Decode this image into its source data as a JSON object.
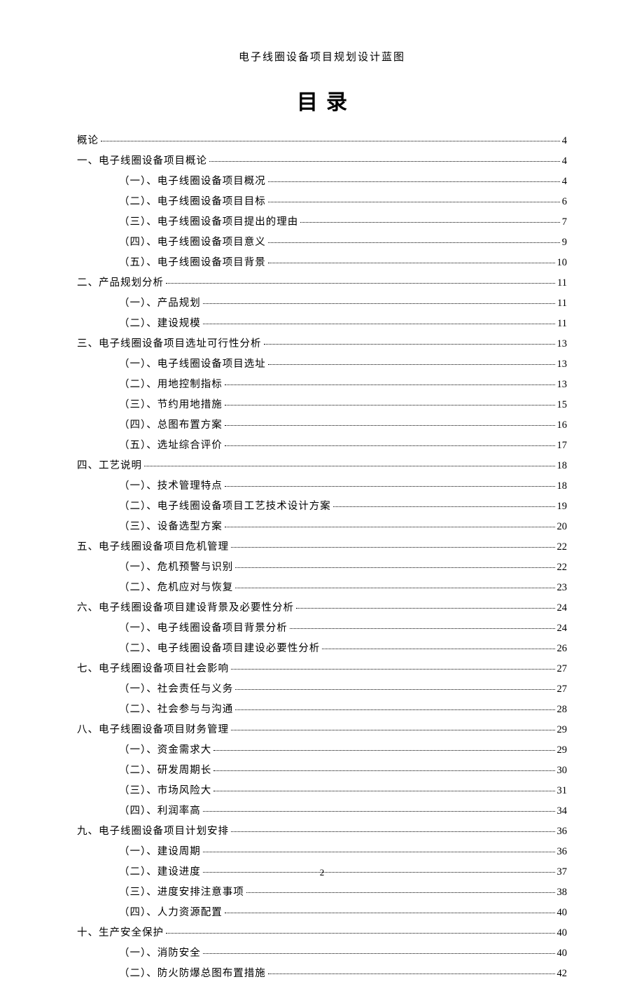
{
  "header": "电子线圈设备项目规划设计蓝图",
  "title": "目录",
  "page_number": "2",
  "toc": [
    {
      "level": 0,
      "label": "概论",
      "page": "4"
    },
    {
      "level": 1,
      "label": "一、电子线圈设备项目概论",
      "page": "4"
    },
    {
      "level": 2,
      "label": "（一）、电子线圈设备项目概况",
      "page": "4"
    },
    {
      "level": 2,
      "label": "（二）、电子线圈设备项目目标",
      "page": "6"
    },
    {
      "level": 2,
      "label": "（三）、电子线圈设备项目提出的理由",
      "page": "7"
    },
    {
      "level": 2,
      "label": "（四）、电子线圈设备项目意义",
      "page": "9"
    },
    {
      "level": 2,
      "label": "（五）、电子线圈设备项目背景",
      "page": "10"
    },
    {
      "level": 1,
      "label": "二、产品规划分析",
      "page": "11"
    },
    {
      "level": 2,
      "label": "（一）、产品规划",
      "page": "11"
    },
    {
      "level": 2,
      "label": "（二）、建设规模",
      "page": "11"
    },
    {
      "level": 1,
      "label": "三、电子线圈设备项目选址可行性分析",
      "page": "13"
    },
    {
      "level": 2,
      "label": "（一）、电子线圈设备项目选址",
      "page": "13"
    },
    {
      "level": 2,
      "label": "（二）、用地控制指标",
      "page": "13"
    },
    {
      "level": 2,
      "label": "（三）、节约用地措施",
      "page": "15"
    },
    {
      "level": 2,
      "label": "（四）、总图布置方案",
      "page": "16"
    },
    {
      "level": 2,
      "label": "（五）、选址综合评价",
      "page": "17"
    },
    {
      "level": 1,
      "label": "四、工艺说明",
      "page": "18"
    },
    {
      "level": 2,
      "label": "（一）、技术管理特点",
      "page": "18"
    },
    {
      "level": 2,
      "label": "（二）、电子线圈设备项目工艺技术设计方案",
      "page": "19"
    },
    {
      "level": 2,
      "label": "（三）、设备选型方案",
      "page": "20"
    },
    {
      "level": 1,
      "label": "五、电子线圈设备项目危机管理",
      "page": "22"
    },
    {
      "level": 2,
      "label": "（一）、危机预警与识别",
      "page": "22"
    },
    {
      "level": 2,
      "label": "（二）、危机应对与恢复",
      "page": "23"
    },
    {
      "level": 1,
      "label": "六、电子线圈设备项目建设背景及必要性分析",
      "page": "24"
    },
    {
      "level": 2,
      "label": "（一）、电子线圈设备项目背景分析",
      "page": "24"
    },
    {
      "level": 2,
      "label": "（二）、电子线圈设备项目建设必要性分析",
      "page": "26"
    },
    {
      "level": 1,
      "label": "七、电子线圈设备项目社会影响",
      "page": "27"
    },
    {
      "level": 2,
      "label": "（一）、社会责任与义务",
      "page": "27"
    },
    {
      "level": 2,
      "label": "（二）、社会参与与沟通",
      "page": "28"
    },
    {
      "level": 1,
      "label": "八、电子线圈设备项目财务管理",
      "page": "29"
    },
    {
      "level": 2,
      "label": "（一）、资金需求大",
      "page": "29"
    },
    {
      "level": 2,
      "label": "（二）、研发周期长",
      "page": "30"
    },
    {
      "level": 2,
      "label": "（三）、市场风险大",
      "page": "31"
    },
    {
      "level": 2,
      "label": "（四）、利润率高",
      "page": "34"
    },
    {
      "level": 1,
      "label": "九、电子线圈设备项目计划安排",
      "page": "36"
    },
    {
      "level": 2,
      "label": "（一）、建设周期",
      "page": "36"
    },
    {
      "level": 2,
      "label": "（二）、建设进度",
      "page": "37"
    },
    {
      "level": 2,
      "label": "（三）、进度安排注意事项",
      "page": "38"
    },
    {
      "level": 2,
      "label": "（四）、人力资源配置",
      "page": "40"
    },
    {
      "level": 1,
      "label": "十、生产安全保护",
      "page": "40"
    },
    {
      "level": 2,
      "label": "（一）、消防安全",
      "page": "40"
    },
    {
      "level": 2,
      "label": "（二）、防火防爆总图布置措施",
      "page": "42"
    }
  ]
}
